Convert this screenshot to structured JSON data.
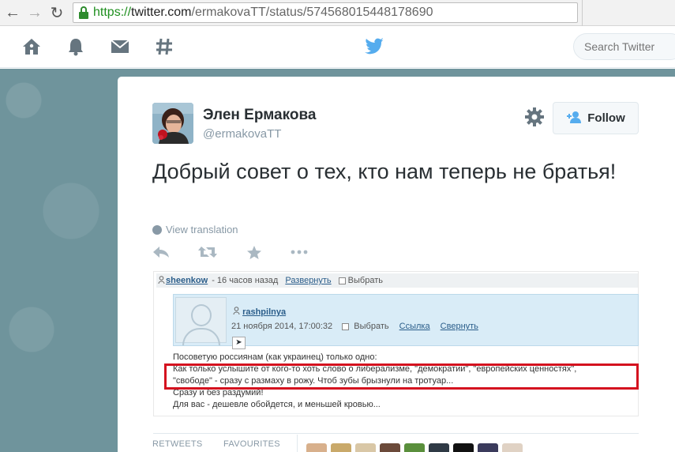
{
  "browser": {
    "url_scheme": "https://",
    "url_host": "twitter.com",
    "url_path": "/ermakovaTT/status/574568015448178690"
  },
  "topbar": {
    "search_placeholder": "Search Twitter"
  },
  "tweet": {
    "author_name": "Элен Ермакова",
    "author_handle": "@ermakovaTT",
    "follow_label": "Follow",
    "text": "Добрый совет о тех, кто нам теперь не братья!",
    "translate_label": "View translation"
  },
  "embedded": {
    "header_user": "sheenkow",
    "header_time": "- 16 часов назад",
    "header_expand": "Развернуть",
    "header_select": "Выбрать",
    "inner_user": "rashpilnya",
    "inner_date": "21 ноября 2014, 17:00:32",
    "inner_select": "Выбрать",
    "inner_link": "Ссылка",
    "inner_collapse": "Свернуть",
    "lines": [
      "Посоветую россиянам (как украинец) только одно:",
      "Как только услышите от кого-то хоть слово о либерализме, \"демократии\", \"европейских ценностях\",",
      "\"свободе\" - сразу с размаху в рожу. Чтоб зубы брызнули на тротуар...",
      "Сразу и без раздумий!",
      "Для вас - дешевле обойдется, и меньшей кровью..."
    ]
  },
  "stats": {
    "retweets_label": "RETWEETS",
    "favourites_label": "FAVOURITES"
  },
  "colors": {
    "twitter_blue": "#55acee",
    "background": "#6f949c",
    "highlight_red": "#d4121f"
  },
  "icons": {
    "top_nav": [
      "home-icon",
      "notifications-icon",
      "messages-icon",
      "discover-icon"
    ],
    "tweet_actions": [
      "reply-icon",
      "retweet-icon",
      "favorite-icon",
      "more-icon"
    ]
  }
}
